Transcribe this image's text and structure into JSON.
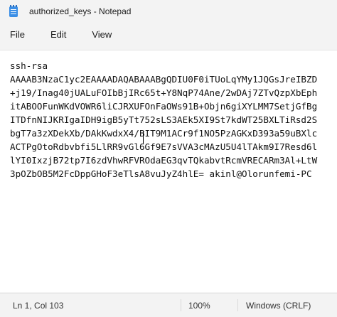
{
  "window": {
    "title": "authorized_keys - Notepad",
    "icon": "notepad-icon"
  },
  "menu": {
    "items": [
      "File",
      "Edit",
      "View"
    ]
  },
  "editor": {
    "lines": [
      "ssh-rsa",
      "AAAAB3NzaC1yc2EAAAADAQABAAABgQDIU0F0iTUoLqYMy1JQGsJreIBZD",
      "+j19/Inag40jUALuFOIbBjIRc65t+Y8NqP74Ane/2wDAj7ZTvQzpXbEph",
      "itABOOFunWKdVOWR6liCJRXUFOnFaOWs91B+Objn6giXYLMM7SetjGfBg",
      "ITDfnNIJKRIgaIDH9igB5yTt752sLS3AEk5XI9St7kdWT25BXLTiRsd2S",
      "bgT7a3zXDekXb/DAkKwdxX4/BIT9M1ACr9f1NO5PzAGKxD393a59uBXlc",
      "ACTPgOtoRdbvbfi5LlRR9vGl6Gf9E7sVVA3cMAzU5U4lTAkm9I7Resd6l",
      "lYI0IxzjB72tp7I6zdVhwRFVROdaEG3qvTQkabvtRcmVRECARm3Al+LtW",
      "3pOZbOB5M2FcDppGHoF3eTlsA8vuJyZ4hlE= akinl@Olorunfemi-PC"
    ]
  },
  "status": {
    "position": "Ln 1, Col 103",
    "zoom": "100%",
    "line_ending": "Windows (CRLF)"
  }
}
